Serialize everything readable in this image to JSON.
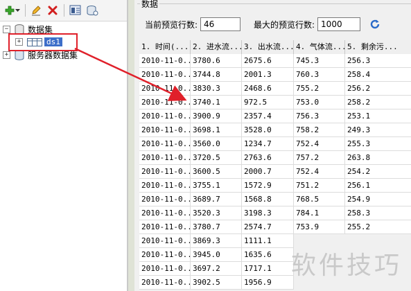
{
  "toolbar": {
    "icons": [
      "add-icon",
      "dropdown-icon",
      "edit-icon",
      "delete-icon",
      "preview-icon",
      "database-icon"
    ]
  },
  "tree": {
    "datasets_label": "数据集",
    "ds1_label": "ds1",
    "server_datasets_label": "服务器数据集"
  },
  "panel": {
    "title": "数据",
    "current_preview_label": "当前预览行数:",
    "current_preview_value": "46",
    "max_preview_label": "最大的预览行数:",
    "max_preview_value": "1000"
  },
  "table": {
    "columns": [
      "1. 时间(...",
      "2. 进水流...",
      "3. 出水流...",
      "4. 气体流...",
      "5. 剩余污..."
    ],
    "rows": [
      [
        "2010-11-0...",
        "3780.6",
        "2675.6",
        "745.3",
        "256.3"
      ],
      [
        "2010-11-0...",
        "3744.8",
        "2001.3",
        "760.3",
        "258.4"
      ],
      [
        "2010-11-0...",
        "3830.3",
        "2468.6",
        "755.2",
        "256.2"
      ],
      [
        "2010-11-0...",
        "3740.1",
        "972.5",
        "753.0",
        "258.2"
      ],
      [
        "2010-11-0...",
        "3900.9",
        "2357.4",
        "756.3",
        "253.1"
      ],
      [
        "2010-11-0...",
        "3698.1",
        "3528.0",
        "758.2",
        "249.3"
      ],
      [
        "2010-11-0...",
        "3560.0",
        "1234.7",
        "752.4",
        "255.3"
      ],
      [
        "2010-11-0...",
        "3720.5",
        "2763.6",
        "757.2",
        "263.8"
      ],
      [
        "2010-11-0...",
        "3600.5",
        "2000.7",
        "752.4",
        "254.2"
      ],
      [
        "2010-11-0...",
        "3755.1",
        "1572.9",
        "751.2",
        "256.1"
      ],
      [
        "2010-11-0...",
        "3689.7",
        "1568.8",
        "768.5",
        "254.9"
      ],
      [
        "2010-11-0...",
        "3520.3",
        "3198.3",
        "784.1",
        "258.3"
      ],
      [
        "2010-11-0...",
        "3780.7",
        "2574.7",
        "753.9",
        "255.2"
      ],
      [
        "2010-11-0...",
        "3869.3",
        "1111.1",
        "",
        ""
      ],
      [
        "2010-11-0...",
        "3945.0",
        "1635.6",
        "",
        ""
      ],
      [
        "2010-11-0...",
        "3697.2",
        "1717.1",
        "",
        ""
      ],
      [
        "2010-11-0...",
        "3902.5",
        "1956.9",
        "",
        ""
      ]
    ]
  },
  "watermark": "软件技巧",
  "colors": {
    "highlight": "#e0202a",
    "selection": "#3d6ec9"
  }
}
